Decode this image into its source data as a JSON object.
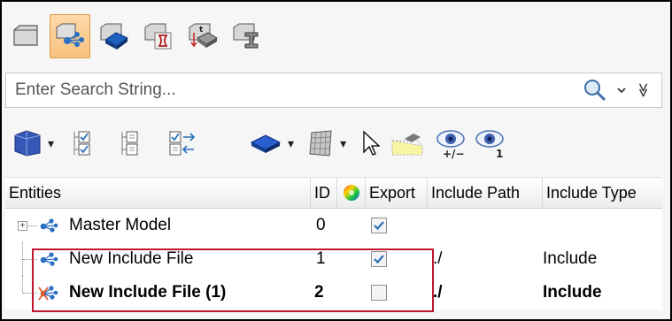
{
  "toolbar_top": {
    "buttons": [
      {
        "icon": "component-view-icon",
        "active": false
      },
      {
        "icon": "include-view-icon",
        "active": true
      },
      {
        "icon": "part-view-icon",
        "active": false
      },
      {
        "icon": "solver-view-icon",
        "active": false
      },
      {
        "icon": "time-history-icon",
        "active": false
      },
      {
        "icon": "beam-section-icon",
        "active": false
      }
    ]
  },
  "search": {
    "placeholder": "Enter Search String...",
    "more_glyph": "≫"
  },
  "tools": {
    "icons": [
      "display-organize-icon",
      "select-all-icon",
      "select-none-icon",
      "reverse-selection-icon",
      "shaded-icon",
      "mesh-icon",
      "cursor-icon",
      "isolate-icon",
      "show-hide-icon",
      "show-only-icon"
    ],
    "eye_labels": [
      "+/−",
      "1"
    ]
  },
  "table": {
    "columns": [
      "Entities",
      "ID",
      "Export",
      "Include Path",
      "Include Type"
    ],
    "rows": [
      {
        "name": "Master Model",
        "id": "0",
        "export": true,
        "path": "",
        "type": "",
        "bold": false
      },
      {
        "name": "New Include File",
        "id": "1",
        "export": true,
        "path": "./",
        "type": "Include",
        "bold": false
      },
      {
        "name": "New Include File (1)",
        "id": "2",
        "export": false,
        "path": "./",
        "type": "Include",
        "bold": true
      }
    ]
  },
  "colors": {
    "accent_highlight": "#c0172f",
    "active_tab": "#f6c27f",
    "check": "#2a6fb8"
  }
}
